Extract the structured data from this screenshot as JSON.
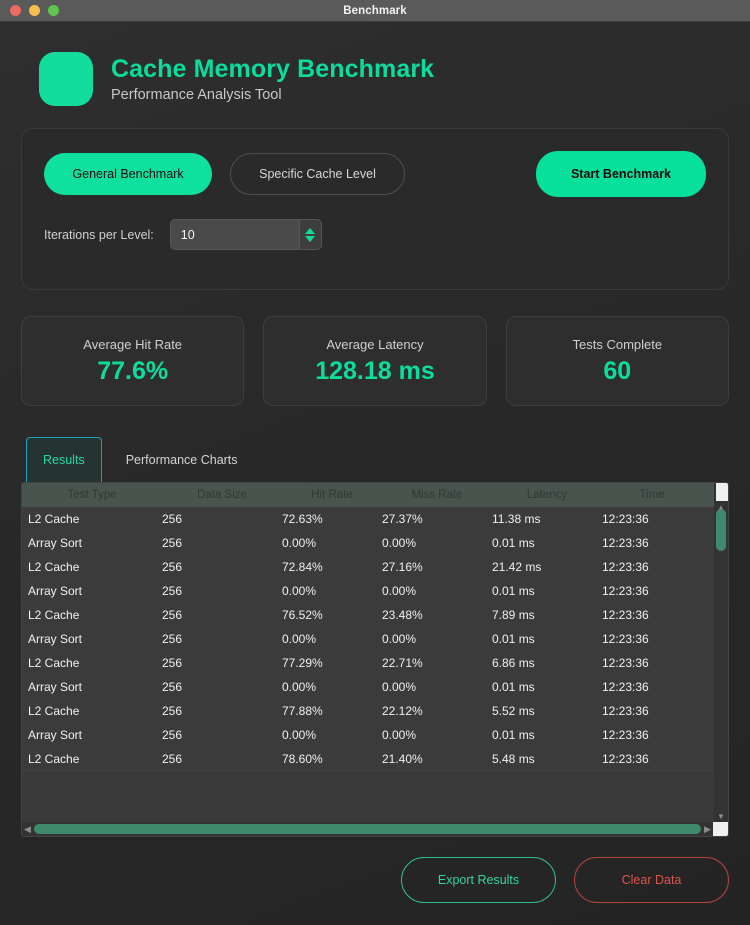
{
  "window": {
    "title": "Benchmark",
    "traffic_lights": [
      "close",
      "minimize",
      "maximize"
    ]
  },
  "header": {
    "title": "Cache Memory Benchmark",
    "subtitle": "Performance Analysis Tool",
    "logo_icon": "app-logo-icon"
  },
  "controls": {
    "mode_general_label": "General Benchmark",
    "mode_specific_label": "Specific Cache Level",
    "start_label": "Start Benchmark",
    "iterations_label": "Iterations per Level:",
    "iterations_value": "10",
    "spinner_up_icon": "triangle-up-icon",
    "spinner_down_icon": "triangle-down-icon"
  },
  "stats": [
    {
      "label": "Average Hit Rate",
      "value": "77.6%"
    },
    {
      "label": "Average Latency",
      "value": "128.18 ms"
    },
    {
      "label": "Tests Complete",
      "value": "60"
    }
  ],
  "tabs": [
    {
      "label": "Results",
      "active": true
    },
    {
      "label": "Performance Charts",
      "active": false
    }
  ],
  "table": {
    "columns": [
      "Test Type",
      "Data Size",
      "Hit Rate",
      "Miss Rate",
      "Latency",
      "Time"
    ],
    "rows": [
      [
        "L2 Cache",
        "256",
        "72.63%",
        "27.37%",
        "11.38 ms",
        "12:23:36"
      ],
      [
        "Array Sort",
        "256",
        "0.00%",
        "0.00%",
        "0.01 ms",
        "12:23:36"
      ],
      [
        "L2 Cache",
        "256",
        "72.84%",
        "27.16%",
        "21.42 ms",
        "12:23:36"
      ],
      [
        "Array Sort",
        "256",
        "0.00%",
        "0.00%",
        "0.01 ms",
        "12:23:36"
      ],
      [
        "L2 Cache",
        "256",
        "76.52%",
        "23.48%",
        "7.89 ms",
        "12:23:36"
      ],
      [
        "Array Sort",
        "256",
        "0.00%",
        "0.00%",
        "0.01 ms",
        "12:23:36"
      ],
      [
        "L2 Cache",
        "256",
        "77.29%",
        "22.71%",
        "6.86 ms",
        "12:23:36"
      ],
      [
        "Array Sort",
        "256",
        "0.00%",
        "0.00%",
        "0.01 ms",
        "12:23:36"
      ],
      [
        "L2 Cache",
        "256",
        "77.88%",
        "22.12%",
        "5.52 ms",
        "12:23:36"
      ],
      [
        "Array Sort",
        "256",
        "0.00%",
        "0.00%",
        "0.01 ms",
        "12:23:36"
      ],
      [
        "L2 Cache",
        "256",
        "78.60%",
        "21.40%",
        "5.48 ms",
        "12:23:36"
      ]
    ],
    "scroll_up_icon": "chevron-up-icon",
    "scroll_down_icon": "chevron-down-icon",
    "scroll_left_icon": "chevron-left-icon",
    "scroll_right_icon": "chevron-right-icon"
  },
  "footer": {
    "export_label": "Export Results",
    "clear_label": "Clear Data"
  },
  "colors": {
    "accent_green": "#0bdd9b",
    "tab_border": "#1f9ec4",
    "danger_red": "#e0524d",
    "scroll_thumb": "#3f8a6d"
  }
}
